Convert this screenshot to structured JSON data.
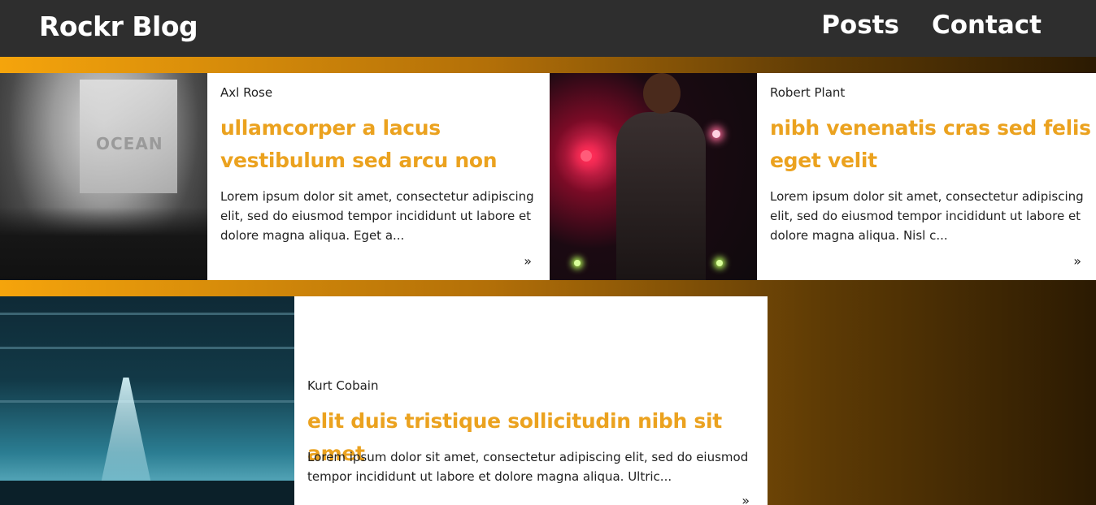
{
  "header": {
    "brand": "Rockr Blog",
    "nav": [
      "Posts",
      "Contact"
    ]
  },
  "posts": [
    {
      "author": "Axl Rose",
      "title": "ullamcorper a lacus vestibulum sed arcu non",
      "excerpt": "Lorem ipsum dolor sit amet, consectetur adipiscing elit, sed do eiusmod tempor incididunt ut labore et dolore magna aliqua. Eget a...",
      "more": "»",
      "image": "concert-crowd-ocean-screen"
    },
    {
      "author": "Robert Plant",
      "title": "nibh venenatis cras sed felis eget velit",
      "excerpt": "Lorem ipsum dolor sit amet, consectetur adipiscing elit, sed do eiusmod tempor incididunt ut labore et dolore magna aliqua. Nisl c...",
      "more": "»",
      "image": "singer-with-microphone"
    },
    {
      "author": "Kurt Cobain",
      "title": "elit duis tristique sollicitudin nibh sit amet",
      "excerpt": "Lorem ipsum dolor sit amet, consectetur adipiscing elit, sed do eiusmod tempor incididunt ut labore et dolore magna aliqua. Ultric...",
      "more": "»",
      "image": "blue-stage-lights"
    }
  ],
  "image_text": {
    "screen": "OCEAN"
  },
  "colors": {
    "header_bg": "#2e2e2e",
    "title": "#eba21f",
    "gradient_start": "#f5a40c",
    "gradient_end": "#2b1a02"
  }
}
